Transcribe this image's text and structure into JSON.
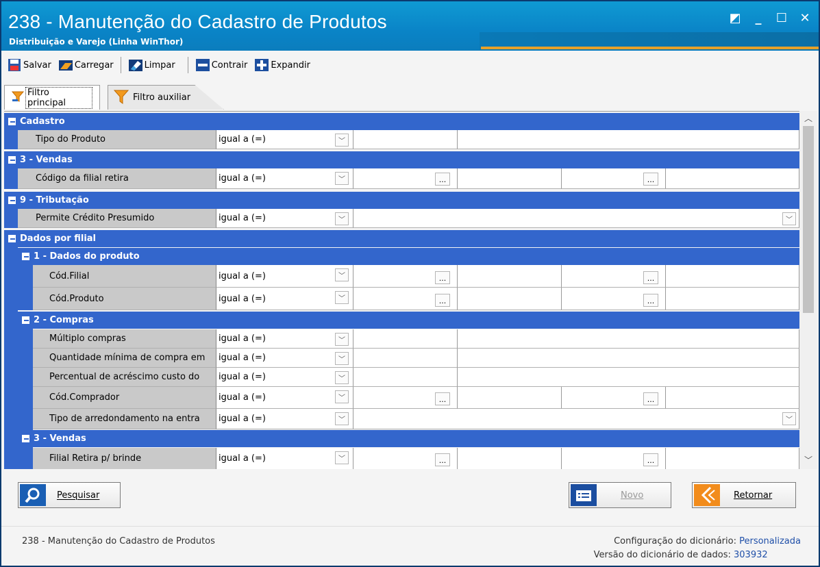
{
  "window": {
    "title": "238 - Manutenção do Cadastro de Produtos",
    "subtitle": "Distribuição e Varejo (Linha WinThor)",
    "controls": [
      "◩",
      "_",
      "☐",
      "✕"
    ]
  },
  "toolbar": {
    "save": "Salvar",
    "load": "Carregar",
    "clear": "Limpar",
    "collapse": "Contrair",
    "expand": "Expandir"
  },
  "tabs": {
    "main": "Filtro principal",
    "aux": "Filtro auxiliar"
  },
  "grid": {
    "groups": {
      "cadastro": "Cadastro",
      "vendas": "3 - Vendas",
      "tributacao": "9 - Tributação",
      "dados_filial": "Dados por filial",
      "dados_produto": "1 - Dados do produto",
      "compras": "2 - Compras",
      "vendas2": "3 - Vendas"
    },
    "operator": "igual a (=)",
    "ellipsis": "...",
    "dropdown_arrow": "﹀",
    "fields": {
      "tipo_produto": "Tipo do Produto",
      "codigo_filial_retira": "Código da filial retira",
      "permite_credito": "Permite Crédito Presumido",
      "cod_filial": "Cód.Filial",
      "cod_produto": "Cód.Produto",
      "multiplo_compras": "Múltiplo compras",
      "qtd_minima": "Quantidade mínima de compra em",
      "percentual_acrescimo": "Percentual de acréscimo custo do",
      "cod_comprador": "Cód.Comprador",
      "tipo_arredondamento": "Tipo de arredondamento na entra",
      "filial_retira_brinde": "Filial Retira p/ brinde"
    }
  },
  "buttons": {
    "search": "Pesquisar",
    "new": "Novo",
    "back": "Retornar"
  },
  "status": {
    "left": "238 - Manutenção do Cadastro de Produtos",
    "config_label": "Configuração do dicionário:",
    "config_value": "Personalizada",
    "version_label": "Versão do dicionário de dados:",
    "version_value": "303932"
  },
  "colors": {
    "title_bar": "#0a84c7",
    "group_header": "#3366cc",
    "accent_orange": "#e5a12a"
  }
}
